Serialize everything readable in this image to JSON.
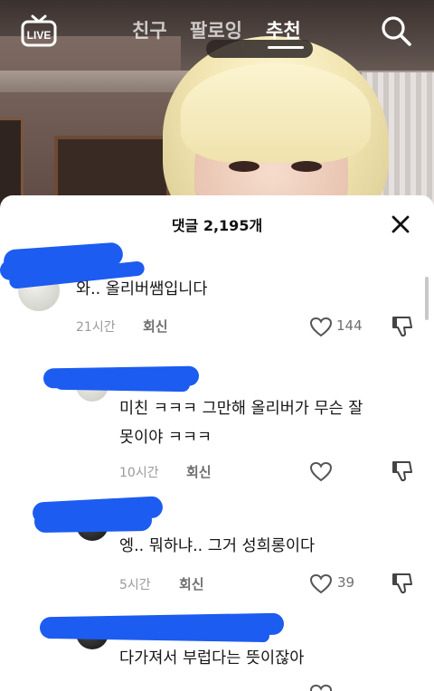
{
  "nav": {
    "live_label": "LIVE",
    "tabs": [
      {
        "label": "친구"
      },
      {
        "label": "팔로잉"
      },
      {
        "label": "추천",
        "active": true
      }
    ]
  },
  "sheet": {
    "title": "댓글 2,195개"
  },
  "comments": [
    {
      "text": "와.. 올리버쌤입니다",
      "time": "21시간",
      "reply": "회신",
      "likes": "144"
    },
    {
      "text": "미친 ㅋㅋㅋ 그만해 올리버가 무슨 잘\n못이야 ㅋㅋㅋ",
      "time": "10시간",
      "reply": "회신",
      "likes": ""
    },
    {
      "text": "엥.. 뭐하냐.. 그거 성희롱이다",
      "time": "5시간",
      "reply": "회신",
      "likes": "39"
    },
    {
      "text": "다가져서 부럽다는 뜻이잖아",
      "time": "",
      "reply": "",
      "likes": ""
    }
  ],
  "colors": {
    "redaction": "#1c5cf0",
    "text": "#161616",
    "meta": "#9a9a9a"
  },
  "icons": [
    "live-icon",
    "search-icon",
    "close-icon",
    "heart-icon",
    "dislike-icon"
  ]
}
